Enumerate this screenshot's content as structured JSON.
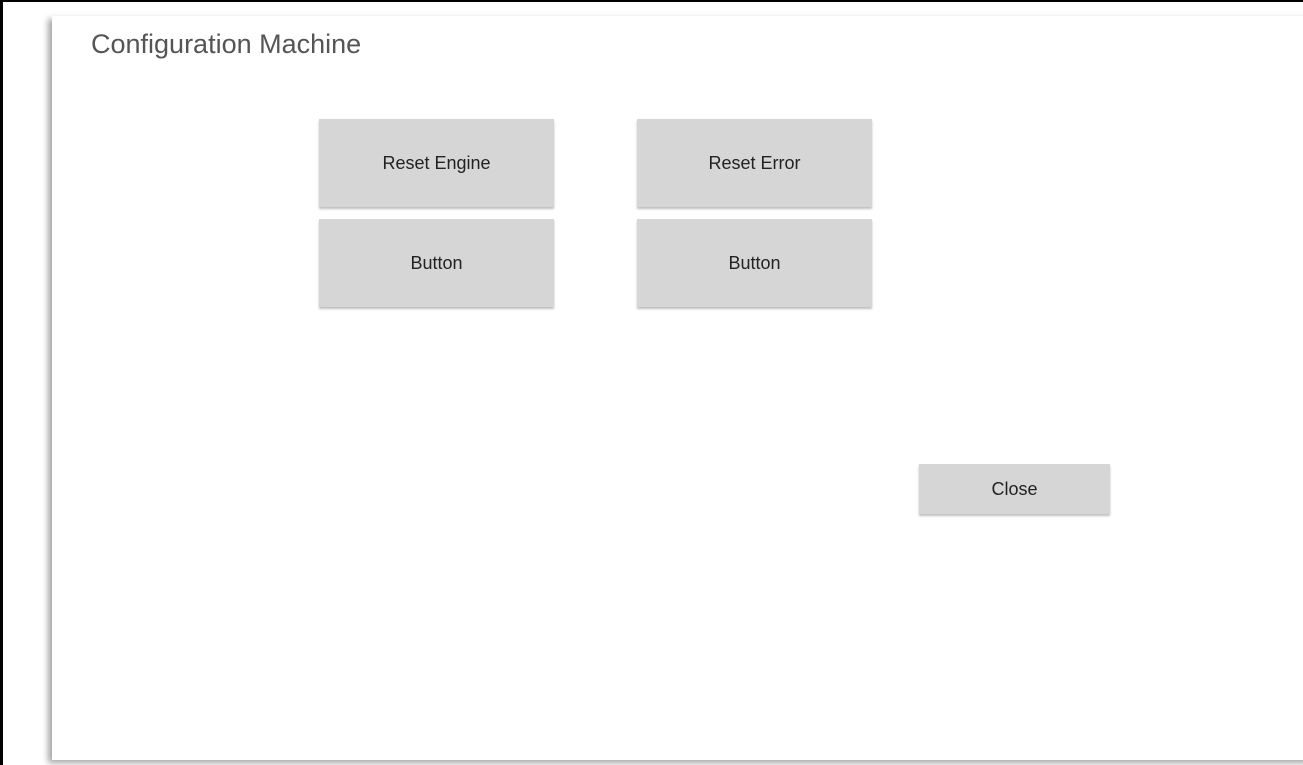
{
  "dialog": {
    "title": "Configuration Machine"
  },
  "buttons": {
    "reset_engine": "Reset Engine",
    "reset_error": "Reset Error",
    "button_1": "Button",
    "button_2": "Button",
    "close": "Close"
  },
  "colors": {
    "background": "#ffffff",
    "button_bg": "#d6d6d6",
    "title_text": "#555555",
    "button_text": "#222222",
    "frame_border": "#000000"
  }
}
